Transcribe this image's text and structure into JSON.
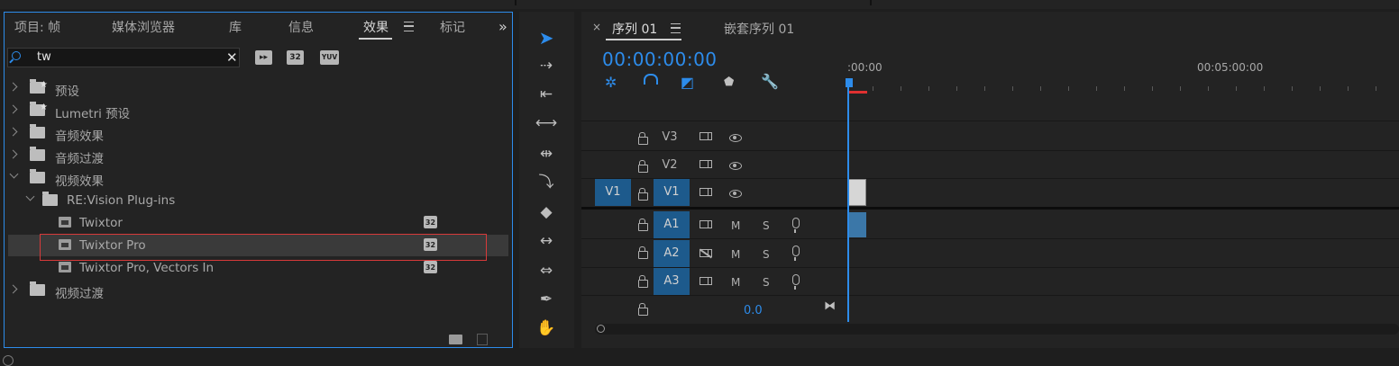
{
  "project_panel": {
    "tabs": [
      {
        "label": "项目: 帧",
        "active": false
      },
      {
        "label": "媒体浏览器",
        "active": false
      },
      {
        "label": "库",
        "active": false
      },
      {
        "label": "信息",
        "active": false
      },
      {
        "label": "效果",
        "active": true
      },
      {
        "label": "标记",
        "active": false
      }
    ],
    "more_icon": "double-chevron-right",
    "search": {
      "value": "tw"
    },
    "filter_badges": [
      "加速",
      "32",
      "YUV"
    ],
    "tree": [
      {
        "label": "预设",
        "type": "folder-star",
        "expanded": false,
        "indent": 0
      },
      {
        "label": "Lumetri 预设",
        "type": "folder-star",
        "expanded": false,
        "indent": 0
      },
      {
        "label": "音频效果",
        "type": "folder",
        "expanded": false,
        "indent": 0
      },
      {
        "label": "音频过渡",
        "type": "folder",
        "expanded": false,
        "indent": 0
      },
      {
        "label": "视频效果",
        "type": "folder",
        "expanded": true,
        "indent": 0
      },
      {
        "label": "RE:Vision Plug-ins",
        "type": "folder",
        "expanded": true,
        "indent": 1
      },
      {
        "label": "Twixtor",
        "type": "effect",
        "badge": "32",
        "indent": 2
      },
      {
        "label": "Twixtor Pro",
        "type": "effect",
        "badge": "32",
        "indent": 2,
        "selected": true
      },
      {
        "label": "Twixtor Pro, Vectors In",
        "type": "effect",
        "badge": "32",
        "indent": 2
      },
      {
        "label": "视频过渡",
        "type": "folder",
        "expanded": false,
        "indent": 0
      }
    ]
  },
  "timeline": {
    "tabs": [
      {
        "label": "序列 01",
        "active": true
      },
      {
        "label": "嵌套序列 01",
        "active": false
      }
    ],
    "timecode": "00:00:00:00",
    "ruler_labels": [
      ":00:00",
      "00:05:00:00"
    ],
    "video_tracks": [
      {
        "name": "V3",
        "source": ""
      },
      {
        "name": "V2",
        "source": ""
      },
      {
        "name": "V1",
        "source": "V1"
      }
    ],
    "audio_tracks": [
      {
        "name": "A1",
        "mute": "M",
        "solo": "S"
      },
      {
        "name": "A2",
        "mute": "M",
        "solo": "S"
      },
      {
        "name": "A3",
        "mute": "M",
        "solo": "S"
      }
    ],
    "master_volume": "0.0"
  },
  "accent_color": "#2d8ceb",
  "track_target_color": "#1d5a8c"
}
